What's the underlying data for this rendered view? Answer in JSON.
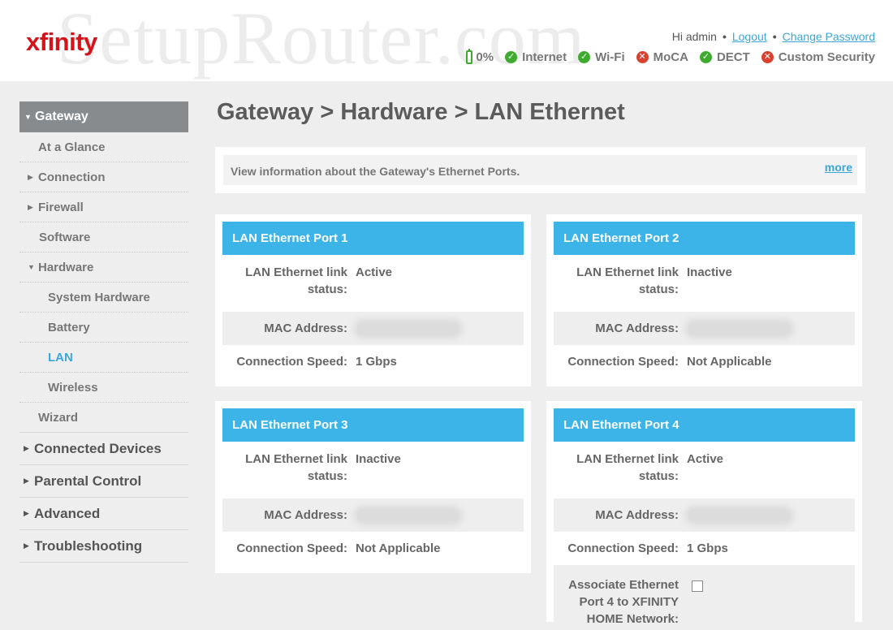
{
  "header": {
    "watermark": "SetupRouter.com",
    "logo": "xfinity",
    "greeting": "Hi admin",
    "logout": "Logout",
    "change_password": "Change Password",
    "status": {
      "battery": "0%",
      "items": [
        {
          "label": "Internet",
          "state": "ok"
        },
        {
          "label": "Wi-Fi",
          "state": "ok"
        },
        {
          "label": "MoCA",
          "state": "error"
        },
        {
          "label": "DECT",
          "state": "ok"
        },
        {
          "label": "Custom Security",
          "state": "error"
        }
      ]
    }
  },
  "sidebar": {
    "gateway": "Gateway",
    "items": {
      "at_a_glance": "At a Glance",
      "connection": "Connection",
      "firewall": "Firewall",
      "software": "Software",
      "hardware": "Hardware",
      "system_hardware": "System Hardware",
      "battery": "Battery",
      "lan": "LAN",
      "wireless": "Wireless",
      "wizard": "Wizard"
    },
    "sections": {
      "connected_devices": "Connected Devices",
      "parental_control": "Parental Control",
      "advanced": "Advanced",
      "troubleshooting": "Troubleshooting"
    }
  },
  "main": {
    "title": "Gateway > Hardware > LAN Ethernet",
    "info": "View information about the Gateway's Ethernet Ports.",
    "more": "more",
    "labels": {
      "link_status": "LAN Ethernet link status:",
      "mac": "MAC Address:",
      "speed": "Connection Speed:",
      "associate": "Associate Ethernet Port 4 to XFINITY HOME Network:"
    },
    "ports": [
      {
        "title": "LAN Ethernet Port 1",
        "status": "Active",
        "speed": "1 Gbps"
      },
      {
        "title": "LAN Ethernet Port 2",
        "status": "Inactive",
        "speed": "Not Applicable"
      },
      {
        "title": "LAN Ethernet Port 3",
        "status": "Inactive",
        "speed": "Not Applicable"
      },
      {
        "title": "LAN Ethernet Port 4",
        "status": "Active",
        "speed": "1 Gbps"
      }
    ]
  },
  "colors": {
    "accent": "#3cb4e7",
    "brand": "#d4131b",
    "ok": "#3eab2f",
    "error": "#d8412d"
  }
}
